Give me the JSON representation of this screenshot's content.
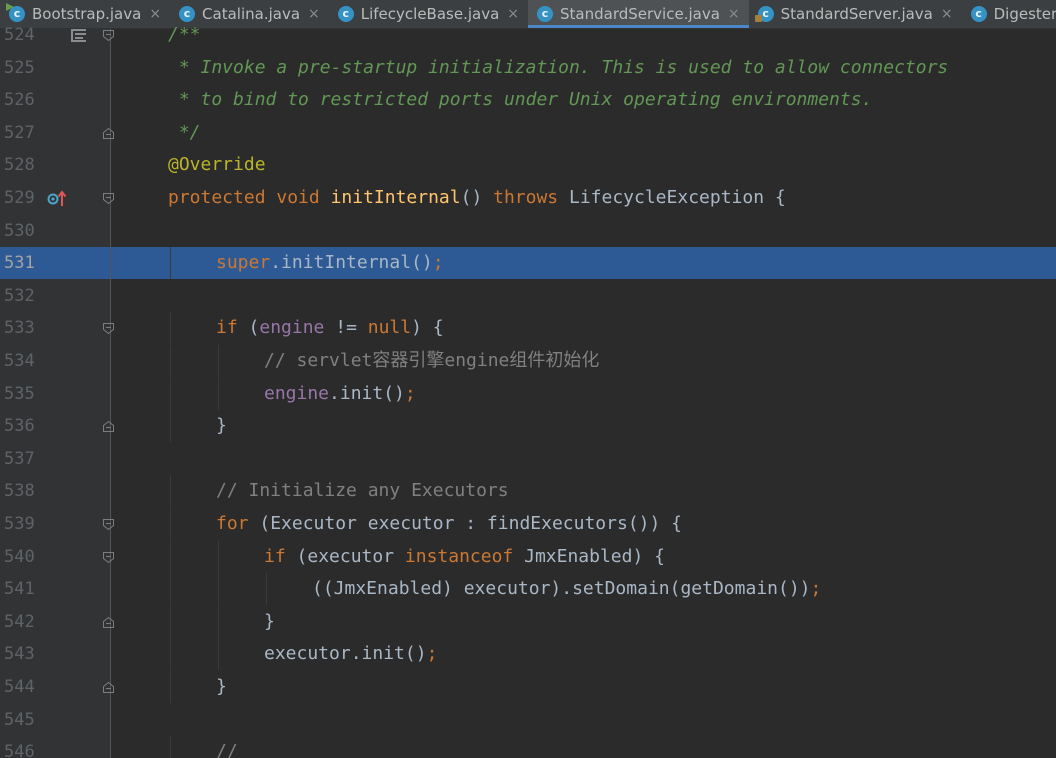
{
  "tabs": [
    {
      "label": "Bootstrap.java",
      "icon": "class-runnable-icon",
      "active": false
    },
    {
      "label": "Catalina.java",
      "icon": "class-icon",
      "active": false
    },
    {
      "label": "LifecycleBase.java",
      "icon": "abstract-class-icon",
      "active": false
    },
    {
      "label": "StandardService.java",
      "icon": "class-icon",
      "active": true
    },
    {
      "label": "StandardServer.java",
      "icon": "class-impl-icon",
      "active": false
    },
    {
      "label": "Digester.java",
      "icon": "class-icon",
      "active": false
    }
  ],
  "tab_close_glyph": "×",
  "class_icon_letter": "c",
  "highlight_line": "531",
  "colors": {
    "background": "#2b2b2b",
    "gutter": "#313335",
    "selection": "#2d5a94",
    "keyword": "#cc7832",
    "doc_comment": "#629755",
    "annotation": "#bbb529",
    "method": "#ffc66d",
    "field": "#9876aa",
    "comment": "#808080",
    "text": "#a9b7c6"
  },
  "lines": [
    {
      "n": "524",
      "fold": "open",
      "structure": true,
      "indent": 0,
      "tokens": [
        {
          "t": "/**",
          "c": "doc"
        }
      ]
    },
    {
      "n": "525",
      "indent": 0,
      "tokens": [
        {
          "t": " * Invoke a pre-startup initialization. This is used to allow connectors",
          "c": "doc"
        }
      ]
    },
    {
      "n": "526",
      "indent": 0,
      "tokens": [
        {
          "t": " * to bind to restricted ports under Unix operating environments.",
          "c": "doc"
        }
      ]
    },
    {
      "n": "527",
      "fold": "close",
      "indent": 0,
      "tokens": [
        {
          "t": " */",
          "c": "doc"
        }
      ]
    },
    {
      "n": "528",
      "indent": 0,
      "tokens": [
        {
          "t": "@Override",
          "c": "anno"
        }
      ]
    },
    {
      "n": "529",
      "fold": "open",
      "impl": true,
      "indent": 0,
      "tokens": [
        {
          "t": "protected void ",
          "c": "kw"
        },
        {
          "t": "initInternal",
          "c": "fn"
        },
        {
          "t": "() ",
          "c": "plain"
        },
        {
          "t": "throws ",
          "c": "kw"
        },
        {
          "t": "LifecycleException {",
          "c": "plain"
        }
      ]
    },
    {
      "n": "530",
      "indent": 0,
      "tokens": []
    },
    {
      "n": "531",
      "indent": 1,
      "tokens": [
        {
          "t": "super",
          "c": "kw"
        },
        {
          "t": ".initInternal()",
          "c": "plain"
        },
        {
          "t": ";",
          "c": "semi"
        }
      ]
    },
    {
      "n": "532",
      "indent": 0,
      "tokens": []
    },
    {
      "n": "533",
      "fold": "open",
      "indent": 1,
      "tokens": [
        {
          "t": "if ",
          "c": "kw"
        },
        {
          "t": "(",
          "c": "plain"
        },
        {
          "t": "engine",
          "c": "field"
        },
        {
          "t": " != ",
          "c": "plain"
        },
        {
          "t": "null",
          "c": "kw"
        },
        {
          "t": ") {",
          "c": "plain"
        }
      ]
    },
    {
      "n": "534",
      "indent": 2,
      "tokens": [
        {
          "t": "// servlet容器引擎engine组件初始化",
          "c": "cmt"
        }
      ]
    },
    {
      "n": "535",
      "indent": 2,
      "tokens": [
        {
          "t": "engine",
          "c": "field"
        },
        {
          "t": ".init()",
          "c": "plain"
        },
        {
          "t": ";",
          "c": "semi"
        }
      ]
    },
    {
      "n": "536",
      "fold": "close",
      "indent": 1,
      "tokens": [
        {
          "t": "}",
          "c": "plain"
        }
      ]
    },
    {
      "n": "537",
      "indent": 0,
      "tokens": []
    },
    {
      "n": "538",
      "indent": 1,
      "tokens": [
        {
          "t": "// Initialize any Executors",
          "c": "cmt"
        }
      ]
    },
    {
      "n": "539",
      "fold": "open",
      "indent": 1,
      "tokens": [
        {
          "t": "for ",
          "c": "kw"
        },
        {
          "t": "(Executor executor : findExecutors()) {",
          "c": "plain"
        }
      ]
    },
    {
      "n": "540",
      "fold": "open",
      "indent": 2,
      "tokens": [
        {
          "t": "if ",
          "c": "kw"
        },
        {
          "t": "(executor ",
          "c": "plain"
        },
        {
          "t": "instanceof ",
          "c": "kw"
        },
        {
          "t": "JmxEnabled) {",
          "c": "plain"
        }
      ]
    },
    {
      "n": "541",
      "indent": 3,
      "tokens": [
        {
          "t": "((JmxEnabled) executor).setDomain(getDomain())",
          "c": "plain"
        },
        {
          "t": ";",
          "c": "semi"
        }
      ]
    },
    {
      "n": "542",
      "fold": "close",
      "indent": 2,
      "tokens": [
        {
          "t": "}",
          "c": "plain"
        }
      ]
    },
    {
      "n": "543",
      "indent": 2,
      "tokens": [
        {
          "t": "executor.init()",
          "c": "plain"
        },
        {
          "t": ";",
          "c": "semi"
        }
      ]
    },
    {
      "n": "544",
      "fold": "close",
      "indent": 1,
      "tokens": [
        {
          "t": "}",
          "c": "plain"
        }
      ]
    },
    {
      "n": "545",
      "indent": 0,
      "tokens": []
    },
    {
      "n": "546",
      "indent": 1,
      "tokens": [
        {
          "t": "//",
          "c": "cmt"
        }
      ]
    }
  ]
}
